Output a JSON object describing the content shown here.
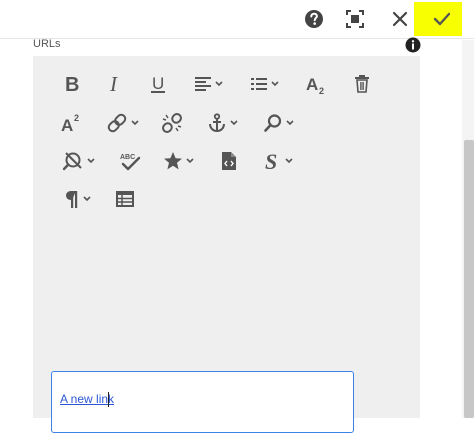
{
  "field": {
    "label": "URLs"
  },
  "header": {
    "help_icon": "help-icon",
    "fullscreen_icon": "fullscreen-icon",
    "close_icon": "close-icon",
    "confirm_icon": "check-icon",
    "highlight_color": "#f7ff00"
  },
  "toolbar": {
    "rows": [
      [
        "bold",
        "italic",
        "underline",
        "paragraph-align",
        "list",
        "subscript",
        "delete"
      ],
      [
        "superscript",
        "link",
        "unlink",
        "anchor",
        "find"
      ],
      [
        "spellcheck-off",
        "spellcheck",
        "special-characters",
        "source-edit",
        "styles"
      ],
      [
        "paragraph-format",
        "table"
      ]
    ]
  },
  "editor": {
    "content": "A new link",
    "link_color": "#2b57d6",
    "focus_border": "#3a82e6"
  }
}
